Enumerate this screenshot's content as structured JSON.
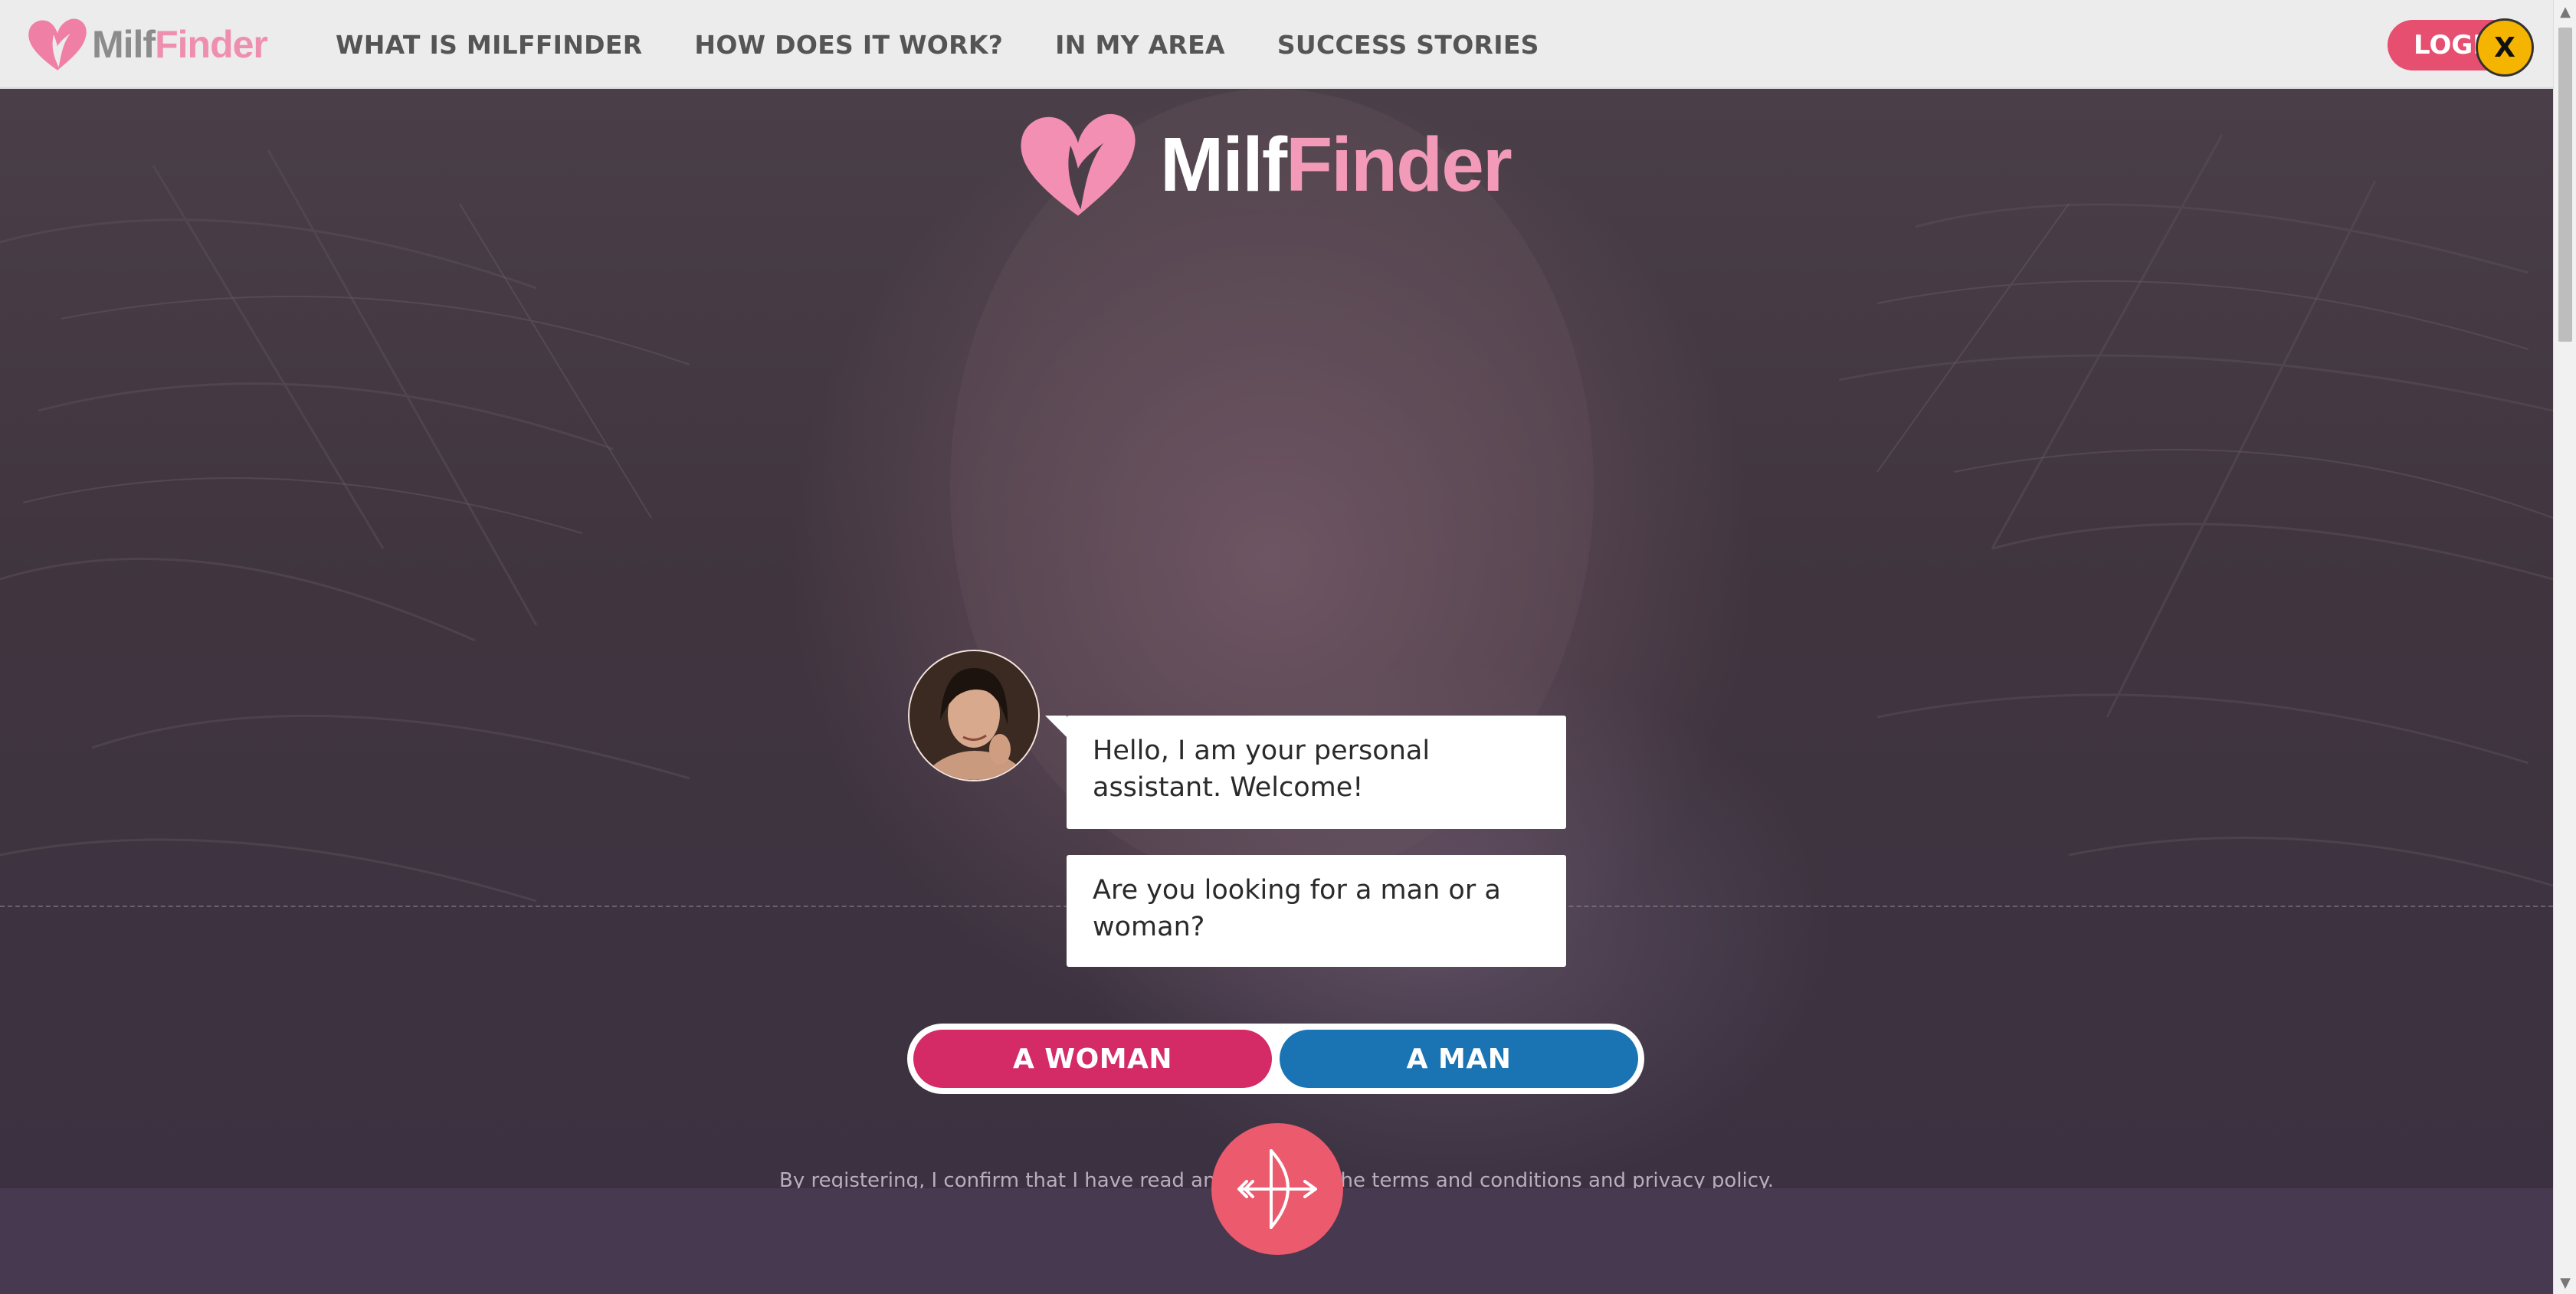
{
  "brand": {
    "milf": "Milf",
    "finder": "Finder"
  },
  "nav": {
    "links": [
      "WHAT IS MILFFINDER",
      "HOW DOES IT WORK?",
      "IN MY AREA",
      "SUCCESS STORIES"
    ],
    "login_label": "LOGIN",
    "close_label": "X"
  },
  "hero": {
    "logo": {
      "milf": "Milf",
      "finder": "Finder"
    },
    "chat": {
      "message1": "Hello, I am your personal assistant. Welcome!",
      "message2": "Are you looking for a man or a woman?"
    },
    "choices": {
      "woman": "A WOMAN",
      "man": "A MAN"
    },
    "terms": {
      "prefix": "By registering, I confirm that I have read and accepted the ",
      "terms_link": "terms and conditions",
      "middle": " and ",
      "privacy_link": "privacy policy",
      "suffix": "."
    }
  },
  "icons": {
    "logo": "heart-icon",
    "cupid": "bow-and-arrow-icon",
    "close": "close-icon"
  },
  "colors": {
    "brand_pink": "#ef8fb0",
    "login": "#e64f6f",
    "woman_button": "#d42b66",
    "man_button": "#1a74b3",
    "close_button": "#f4b400",
    "cupid_circle": "#ec5a6e",
    "hero_overlay": "#3e3346"
  }
}
